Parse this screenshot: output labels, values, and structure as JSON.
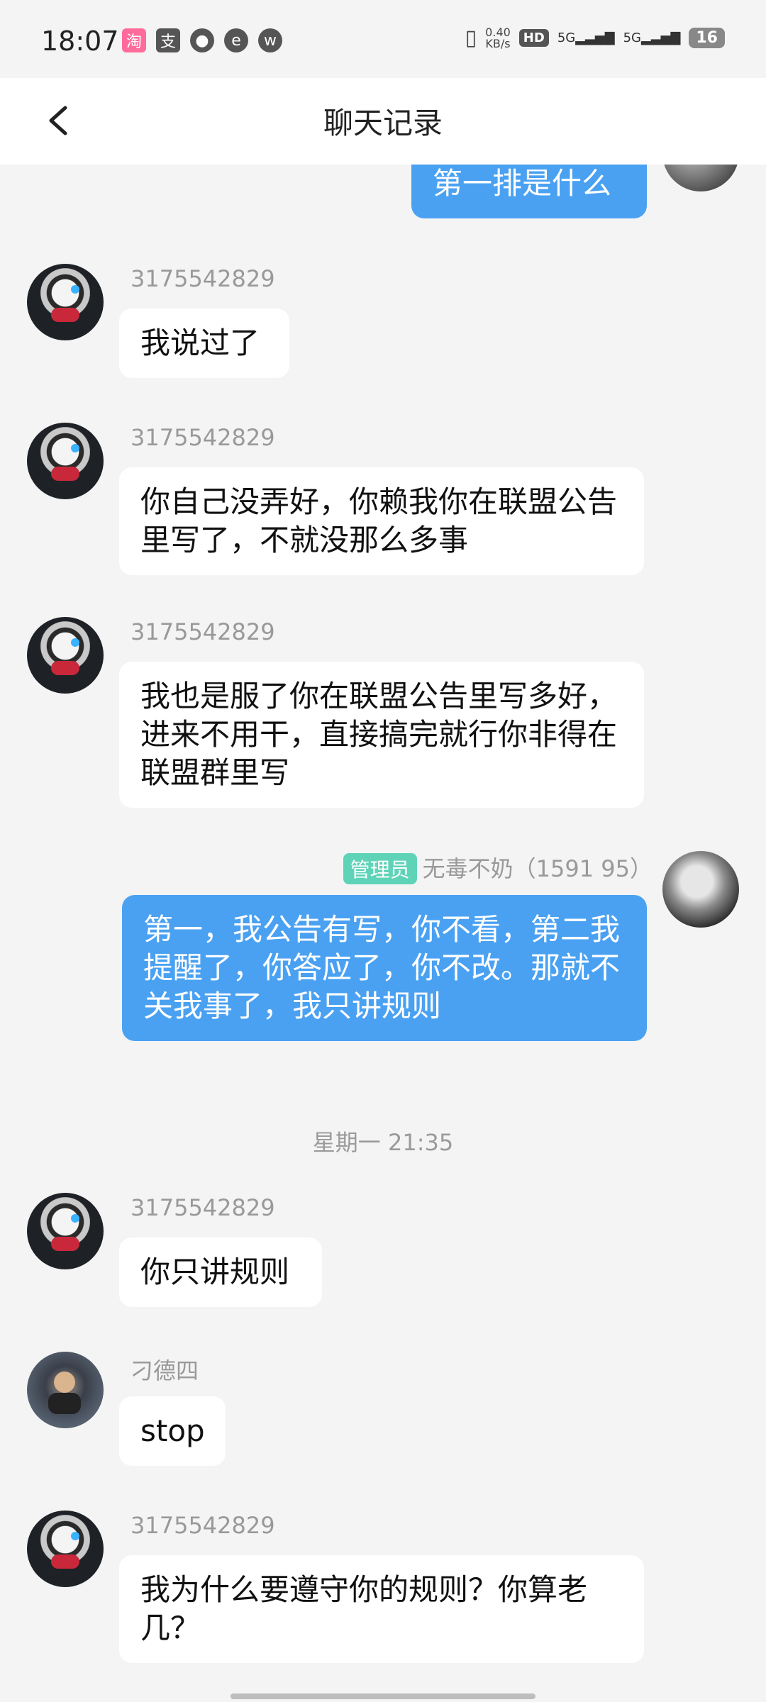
{
  "status_bar": {
    "time": "18:07",
    "net_speed_value": "0.40",
    "net_speed_unit": "KB/s",
    "hd_label": "HD",
    "sim1_label": "5G",
    "sim2_label": "5G",
    "battery": "16",
    "app_icons": [
      "taobao-icon",
      "alipay-icon",
      "message-icon",
      "netease-icon",
      "weibo-icon"
    ]
  },
  "header": {
    "title": "聊天记录"
  },
  "messages": [
    {
      "direction": "out",
      "text": "第一排是什么"
    },
    {
      "direction": "in",
      "sender": "3175542829",
      "text": "我说过了"
    },
    {
      "direction": "in",
      "sender": "3175542829",
      "text": "你自己没弄好，你赖我你在联盟公告里写了，不就没那么多事"
    },
    {
      "direction": "in",
      "sender": "3175542829",
      "text": "我也是服了你在联盟公告里写多好，进来不用干，直接搞完就行你非得在联盟群里写"
    },
    {
      "direction": "out",
      "role": "管理员",
      "sender": "无毒不奶（1591 95）",
      "text": "第一，我公告有写，你不看，第二我提醒了，你答应了，你不改。那就不关我事了，我只讲规则"
    },
    {
      "direction": "in",
      "sender": "3175542829",
      "text": "你只讲规则"
    },
    {
      "direction": "in",
      "sender": "刁德四",
      "text": "stop"
    },
    {
      "direction": "in",
      "sender": "3175542829",
      "text": "我为什么要遵守你的规则？你算老几？"
    }
  ],
  "timestamp_divider": "星期一 21:35",
  "colors": {
    "outgoing_bubble": "#4aa1f2",
    "incoming_bubble": "#ffffff",
    "background": "#f4f4f4",
    "admin_badge": "#5fd3b8"
  }
}
